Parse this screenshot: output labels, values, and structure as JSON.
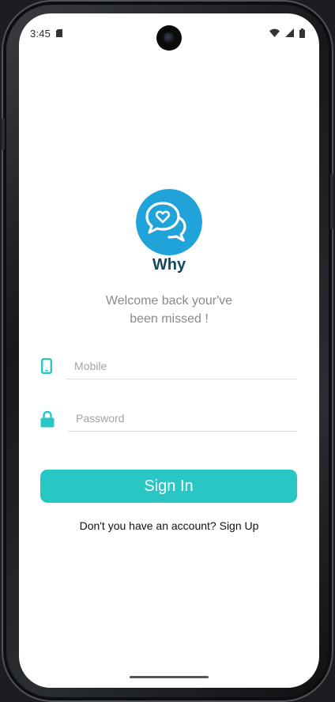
{
  "status_bar": {
    "time": "3:45"
  },
  "app": {
    "name": "Why",
    "welcome_line1": "Welcome back your've",
    "welcome_line2": "been missed !"
  },
  "form": {
    "mobile_placeholder": "Mobile",
    "mobile_value": "",
    "password_placeholder": "Password",
    "password_value": "",
    "signin_label": "Sign In"
  },
  "footer": {
    "prompt": "Don't you have an account?",
    "signup_label": "Sign Up"
  },
  "colors": {
    "accent": "#29c6c6",
    "logo_blue": "#1fa3d9",
    "title": "#12485b"
  },
  "icons": {
    "logo": "chat-bubbles-heart-icon",
    "mobile": "phone-icon",
    "password": "lock-icon",
    "status_sd": "sd-card-icon",
    "wifi": "wifi-icon",
    "signal": "cell-signal-icon",
    "battery": "battery-icon"
  }
}
